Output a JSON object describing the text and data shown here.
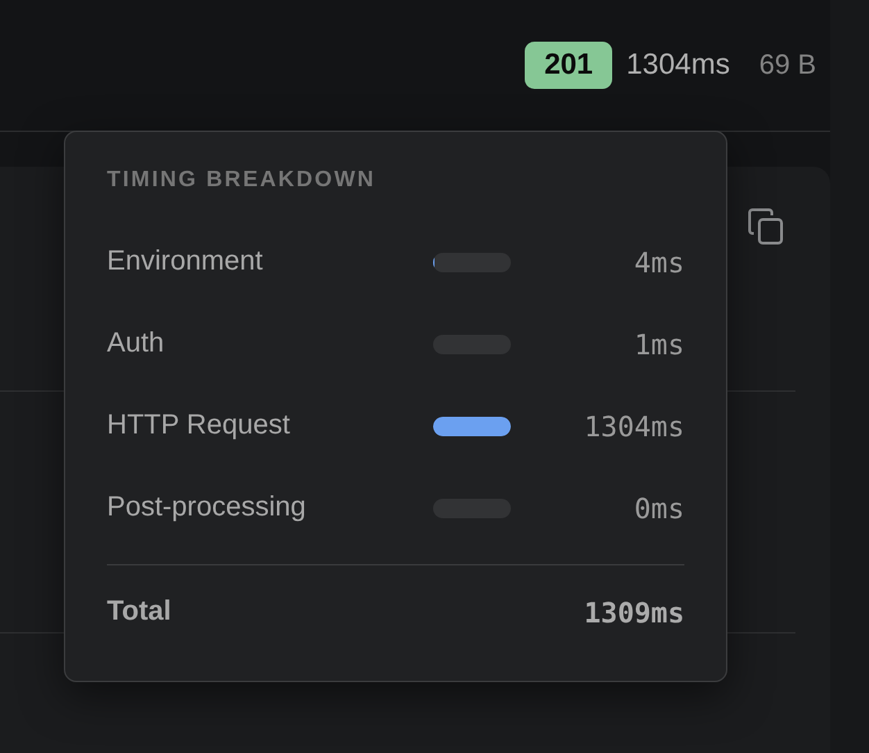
{
  "response_meta": {
    "status": "201",
    "duration": "1304ms",
    "size": "69 B"
  },
  "timing_breakdown": {
    "title": "TIMING BREAKDOWN",
    "phases": [
      {
        "label": "Environment",
        "level": 0.003,
        "duration": "4ms"
      },
      {
        "label": "Auth",
        "level": 0.001,
        "duration": "1ms"
      },
      {
        "label": "HTTP Request",
        "level": 1.0,
        "duration": "1304ms"
      },
      {
        "label": "Post-processing",
        "level": 0,
        "duration": "0ms"
      }
    ],
    "total": {
      "label": "Total",
      "duration": "1309ms"
    }
  }
}
